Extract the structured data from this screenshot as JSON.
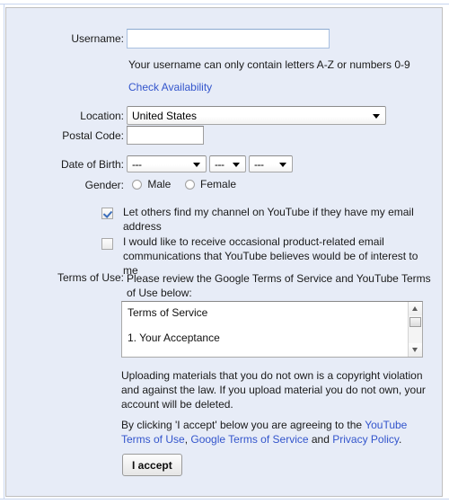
{
  "form": {
    "username": {
      "label": "Username:",
      "value": "",
      "placeholder": "",
      "hint": "Your username can only contain letters A-Z or numbers 0-9",
      "check_availability_link": "Check Availability"
    },
    "location": {
      "label": "Location:",
      "selected": "United States"
    },
    "postal_code": {
      "label": "Postal Code:",
      "value": "",
      "placeholder": ""
    },
    "date_of_birth": {
      "label": "Date of Birth:",
      "month": "---",
      "day": "---",
      "year": "---"
    },
    "gender": {
      "label": "Gender:",
      "options": [
        {
          "label": "Male",
          "selected": false
        },
        {
          "label": "Female",
          "selected": false
        }
      ]
    },
    "checkboxes": [
      {
        "text": "Let others find my channel on YouTube if they have my email address",
        "checked": true
      },
      {
        "text": "I would like to receive occasional product-related email communications that YouTube believes would be of interest to me",
        "checked": false
      }
    ],
    "terms": {
      "label": "Terms of Use:",
      "intro": "Please review the Google Terms of Service and YouTube Terms of Use below:",
      "scroll_heading": "Terms of Service",
      "scroll_clause": "1. Your Acceptance",
      "copyright_notice": "Uploading materials that you do not own is a copyright violation and against the law. If you upload material you do not own, your account will be deleted.",
      "accept_notice_prefix": "By clicking 'I accept' below you are agreeing to the ",
      "link_youtube_terms": "YouTube Terms of Use",
      "accept_notice_sep1": ", ",
      "link_google_terms": "Google Terms of Service",
      "accept_notice_sep2": " and ",
      "link_privacy_policy": "Privacy Policy",
      "accept_notice_suffix": "."
    },
    "submit_button": "I accept"
  },
  "colors": {
    "panel_background": "#e7ecf7",
    "panel_border": "#bfbfbf",
    "link": "#3355cc",
    "text": "#1a1a1a",
    "input_border_focus": "#a8c0e0",
    "checkbox_check": "#3b6ebb"
  }
}
